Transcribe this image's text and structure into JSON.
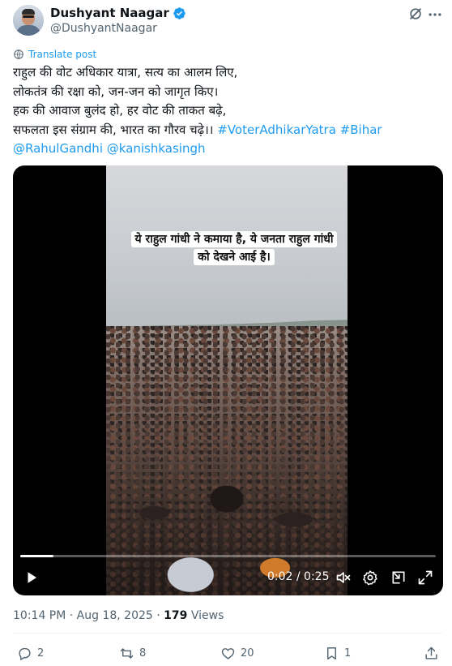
{
  "author": {
    "name": "Dushyant Naagar",
    "handle": "@DushyantNaagar"
  },
  "translate_label": "Translate post",
  "post": {
    "lines": [
      "राहुल की वोट अधिकार यात्रा, सत्य का आलम लिए,",
      "लोकतंत्र की रक्षा को, जन-जन को जागृत किए।",
      "हक की आवाज बुलंद हो, हर वोट की ताकत बढ़े,"
    ],
    "line4_text": "सफलता इस संग्राम की, भारत का गौरव चढ़े।। ",
    "hashtag1": "#VoterAdhikarYatra",
    "hashtag2": "#Bihar",
    "mention1": "@RahulGandhi",
    "mention2": "@kanishkasingh"
  },
  "video": {
    "caption_line1": "ये राहुल गांधी ने कमाया है, ये जनता राहुल गांधी",
    "caption_line2": "को देखने आई है।",
    "time": "0:02 / 0:25",
    "progress": 0.08
  },
  "meta": {
    "timestamp": "10:14 PM · Aug 18, 2025 · ",
    "views_count": "179",
    "views_label": " Views"
  },
  "actions": {
    "replies": "2",
    "reposts": "8",
    "likes": "20",
    "bookmarks": "1"
  },
  "colors": {
    "accent": "#1d9bf0",
    "text": "#0f1419",
    "secondary": "#536471"
  },
  "icons": [
    "verified-badge-icon",
    "grok-icon",
    "more-icon",
    "translate-icon",
    "play-icon",
    "volume-muted-icon",
    "settings-icon",
    "pip-icon",
    "fullscreen-icon",
    "reply-icon",
    "repost-icon",
    "like-icon",
    "bookmark-icon",
    "share-icon"
  ]
}
